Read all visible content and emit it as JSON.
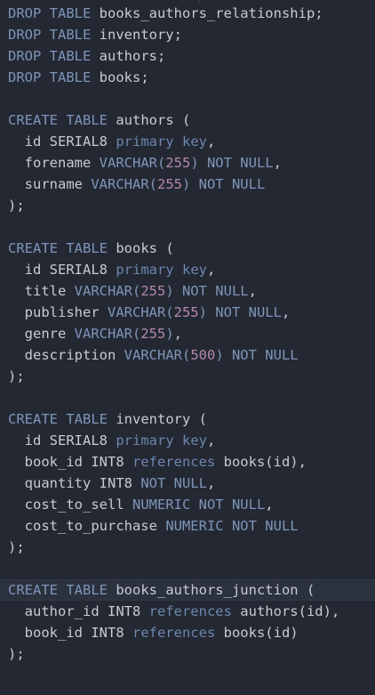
{
  "editor": {
    "lines": [
      [
        {
          "t": "DROP TABLE ",
          "c": "kw"
        },
        {
          "t": "books_authors_relationship",
          "c": "ident"
        },
        {
          "t": ";",
          "c": "punc"
        }
      ],
      [
        {
          "t": "DROP TABLE ",
          "c": "kw"
        },
        {
          "t": "inventory",
          "c": "ident"
        },
        {
          "t": ";",
          "c": "punc"
        }
      ],
      [
        {
          "t": "DROP TABLE ",
          "c": "kw"
        },
        {
          "t": "authors",
          "c": "ident"
        },
        {
          "t": ";",
          "c": "punc"
        }
      ],
      [
        {
          "t": "DROP TABLE ",
          "c": "kw"
        },
        {
          "t": "books",
          "c": "ident"
        },
        {
          "t": ";",
          "c": "punc"
        }
      ],
      [],
      [
        {
          "t": "CREATE TABLE ",
          "c": "kw"
        },
        {
          "t": "authors",
          "c": "ident"
        },
        {
          "t": " (",
          "c": "punc"
        }
      ],
      [
        {
          "t": "  id SERIAL8 ",
          "c": "ident"
        },
        {
          "t": "primary key",
          "c": "mod"
        },
        {
          "t": ",",
          "c": "punc"
        }
      ],
      [
        {
          "t": "  forename ",
          "c": "ident"
        },
        {
          "t": "VARCHAR(",
          "c": "typ"
        },
        {
          "t": "255",
          "c": "num"
        },
        {
          "t": ") NOT NULL",
          "c": "typ"
        },
        {
          "t": ",",
          "c": "punc"
        }
      ],
      [
        {
          "t": "  surname ",
          "c": "ident"
        },
        {
          "t": "VARCHAR(",
          "c": "typ"
        },
        {
          "t": "255",
          "c": "num"
        },
        {
          "t": ") NOT NULL",
          "c": "typ"
        }
      ],
      [
        {
          "t": ");",
          "c": "punc"
        }
      ],
      [],
      [
        {
          "t": "CREATE TABLE ",
          "c": "kw"
        },
        {
          "t": "books",
          "c": "ident"
        },
        {
          "t": " (",
          "c": "punc"
        }
      ],
      [
        {
          "t": "  id SERIAL8 ",
          "c": "ident"
        },
        {
          "t": "primary key",
          "c": "mod"
        },
        {
          "t": ",",
          "c": "punc"
        }
      ],
      [
        {
          "t": "  title ",
          "c": "ident"
        },
        {
          "t": "VARCHAR(",
          "c": "typ"
        },
        {
          "t": "255",
          "c": "num"
        },
        {
          "t": ") NOT NULL",
          "c": "typ"
        },
        {
          "t": ",",
          "c": "punc"
        }
      ],
      [
        {
          "t": "  publisher ",
          "c": "ident"
        },
        {
          "t": "VARCHAR(",
          "c": "typ"
        },
        {
          "t": "255",
          "c": "num"
        },
        {
          "t": ") NOT NULL",
          "c": "typ"
        },
        {
          "t": ",",
          "c": "punc"
        }
      ],
      [
        {
          "t": "  genre ",
          "c": "ident"
        },
        {
          "t": "VARCHAR(",
          "c": "typ"
        },
        {
          "t": "255",
          "c": "num"
        },
        {
          "t": ")",
          "c": "typ"
        },
        {
          "t": ",",
          "c": "punc"
        }
      ],
      [
        {
          "t": "  description ",
          "c": "ident"
        },
        {
          "t": "VARCHAR(",
          "c": "typ"
        },
        {
          "t": "500",
          "c": "num"
        },
        {
          "t": ") NOT NULL",
          "c": "typ"
        }
      ],
      [
        {
          "t": ");",
          "c": "punc"
        }
      ],
      [],
      [
        {
          "t": "CREATE TABLE ",
          "c": "kw"
        },
        {
          "t": "inventory",
          "c": "ident"
        },
        {
          "t": " (",
          "c": "punc"
        }
      ],
      [
        {
          "t": "  id SERIAL8 ",
          "c": "ident"
        },
        {
          "t": "primary key",
          "c": "mod"
        },
        {
          "t": ",",
          "c": "punc"
        }
      ],
      [
        {
          "t": "  book_id INT8 ",
          "c": "ident"
        },
        {
          "t": "references",
          "c": "mod"
        },
        {
          "t": " books(id),",
          "c": "ident"
        }
      ],
      [
        {
          "t": "  quantity INT8 ",
          "c": "ident"
        },
        {
          "t": "NOT NULL",
          "c": "typ"
        },
        {
          "t": ",",
          "c": "punc"
        }
      ],
      [
        {
          "t": "  cost_to_sell ",
          "c": "ident"
        },
        {
          "t": "NUMERIC NOT NULL",
          "c": "typ"
        },
        {
          "t": ",",
          "c": "punc"
        }
      ],
      [
        {
          "t": "  cost_to_purchase ",
          "c": "ident"
        },
        {
          "t": "NUMERIC NOT NULL",
          "c": "typ"
        }
      ],
      [
        {
          "t": ");",
          "c": "punc"
        }
      ],
      [],
      [
        {
          "t": "CREATE TABLE ",
          "c": "kw"
        },
        {
          "t": "books_authors_junction",
          "c": "ident"
        },
        {
          "t": " (",
          "c": "punc"
        }
      ],
      [
        {
          "t": "  author_id INT8 ",
          "c": "ident"
        },
        {
          "t": "references",
          "c": "mod"
        },
        {
          "t": " authors(id),",
          "c": "ident"
        }
      ],
      [
        {
          "t": "  book_id INT8 ",
          "c": "ident"
        },
        {
          "t": "references",
          "c": "mod"
        },
        {
          "t": " books(id)",
          "c": "ident"
        }
      ],
      [
        {
          "t": ");",
          "c": "punc"
        }
      ]
    ],
    "current_line": 27
  }
}
